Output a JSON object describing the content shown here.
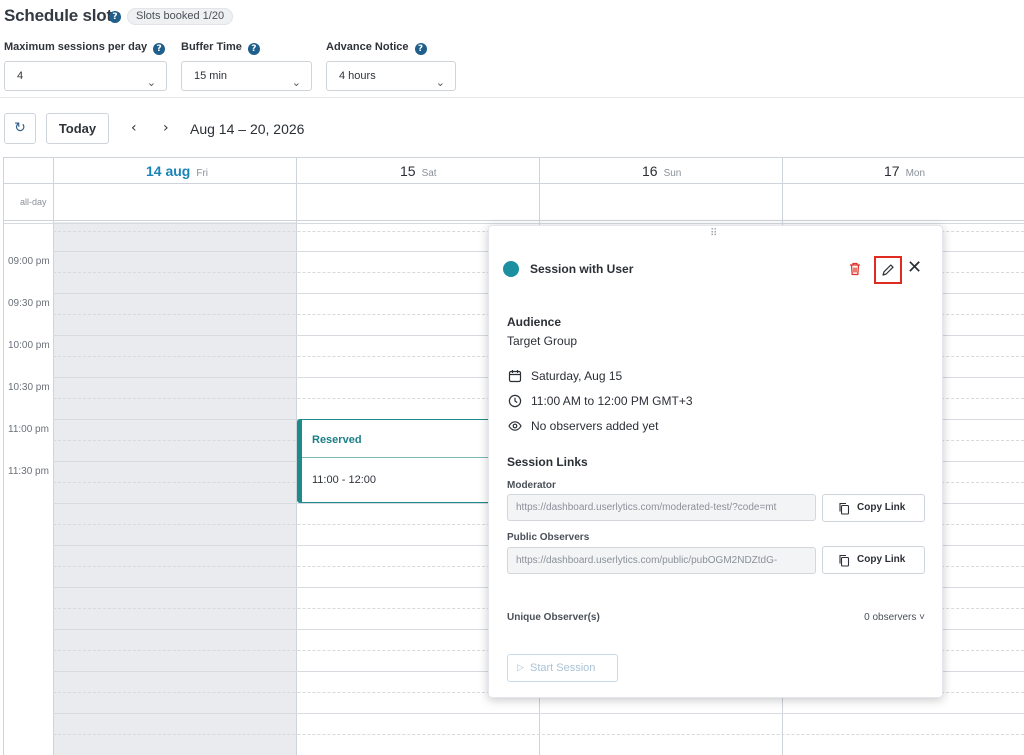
{
  "header": {
    "title": "Schedule slots",
    "help_glyph": "?",
    "slots_badge": "Slots booked 1/20"
  },
  "settings": [
    {
      "label": "Maximum sessions per day",
      "value": "4"
    },
    {
      "label": "Buffer Time",
      "value": "15 min"
    },
    {
      "label": "Advance Notice",
      "value": "4 hours"
    }
  ],
  "toolbar": {
    "refresh_glyph": "↻",
    "today_label": "Today",
    "prev_glyph": "‹",
    "next_glyph": "›",
    "date_range": "Aug 14 – 20, 2026"
  },
  "calendar": {
    "days": [
      {
        "num": "14 aug",
        "dow": "Fri",
        "is_today": true
      },
      {
        "num": "15",
        "dow": "Sat",
        "is_today": false
      },
      {
        "num": "16",
        "dow": "Sun",
        "is_today": false
      },
      {
        "num": "17",
        "dow": "Mon",
        "is_today": false
      }
    ],
    "allday_label": "all-day",
    "times": [
      "09:00 pm",
      "09:30 pm",
      "10:00 pm",
      "10:30 pm",
      "11:00 pm",
      "11:30 pm"
    ],
    "event": {
      "title": "Reserved",
      "time": "11:00 - 12:00",
      "color": "#1f8a8a"
    }
  },
  "popup": {
    "drag_glyph": "⠿",
    "title": "Session with User",
    "dot_color": "#1c8fa1",
    "close_glyph": "✕",
    "audience_heading": "Audience",
    "audience_value": "Target Group",
    "date": "Saturday, Aug 15",
    "time": "11:00 AM to 12:00 PM GMT+3",
    "observers_note": "No observers added yet",
    "links_heading": "Session Links",
    "moderator_label": "Moderator",
    "moderator_url": "https://dashboard.userlytics.com/moderated-test/?code=mt",
    "public_label": "Public Observers",
    "public_url": "https://dashboard.userlytics.com/public/pubOGM2NDZtdG-",
    "copy_label": "Copy Link",
    "unique_label": "Unique Observer(s)",
    "unique_count": "0 observers ˅",
    "start_label": "Start Session",
    "start_glyph": "▷"
  }
}
